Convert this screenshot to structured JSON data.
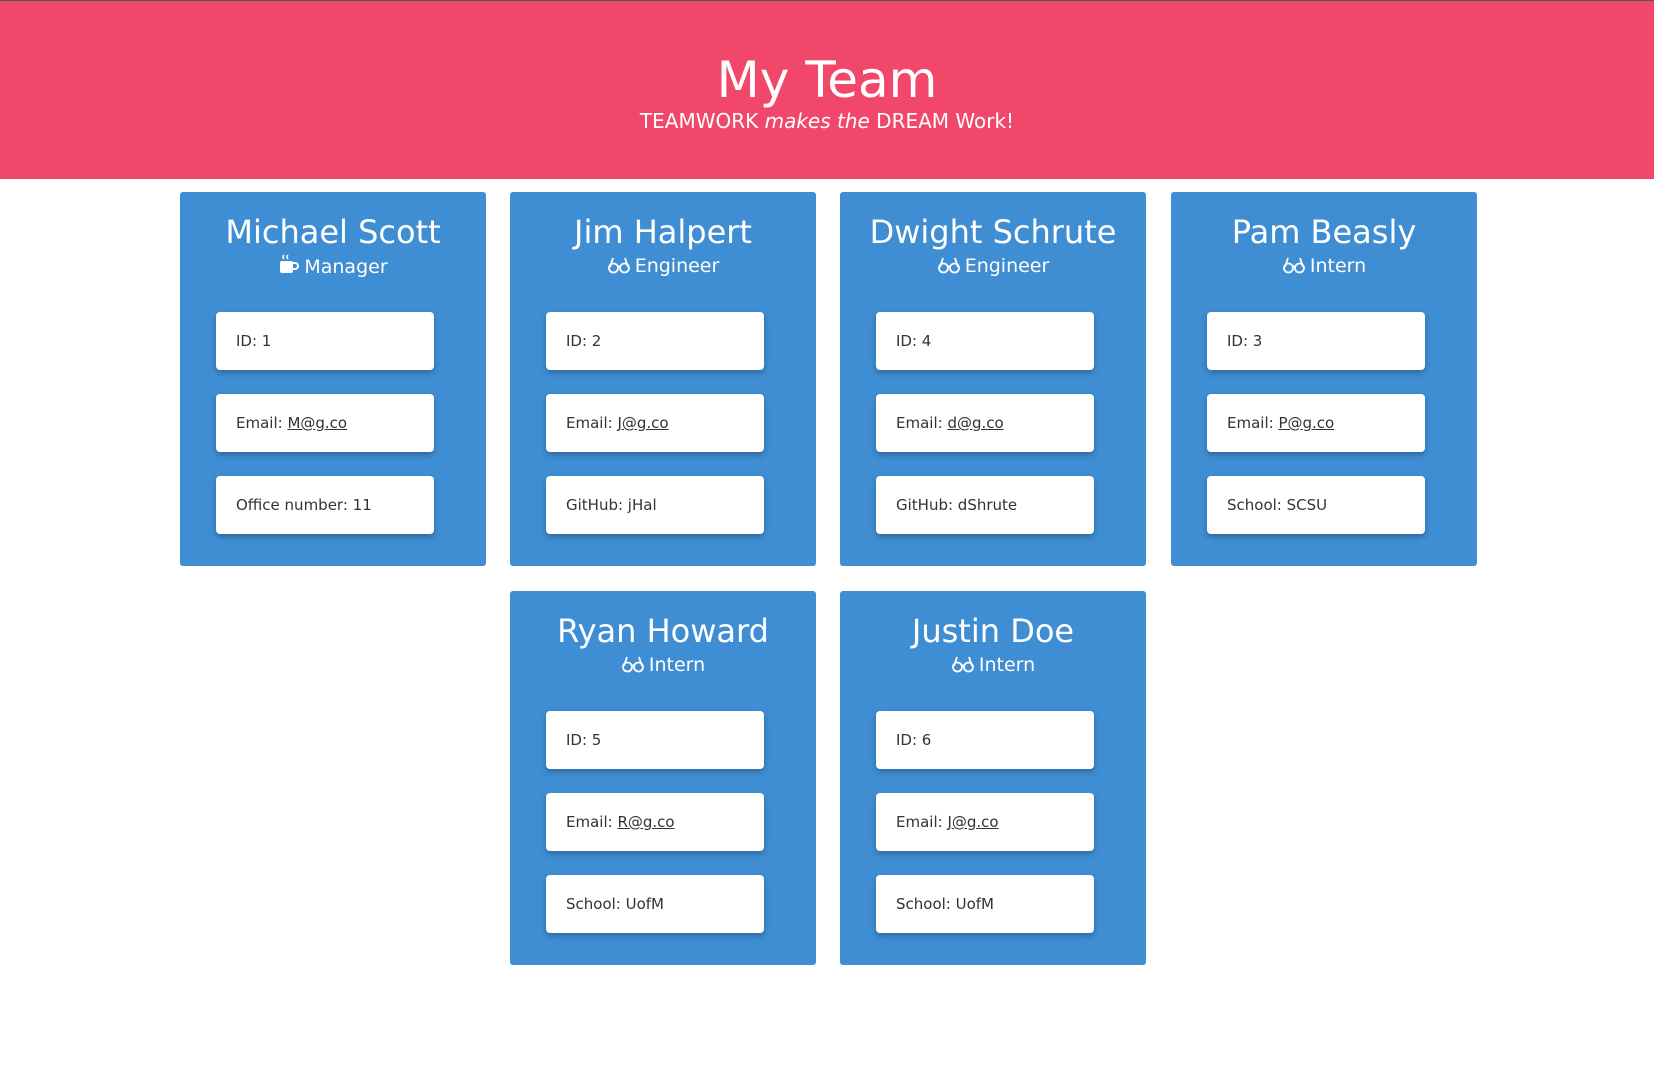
{
  "header": {
    "title": "My Team",
    "tagline_part1": "TEAMWORK ",
    "tagline_italic": "makes the",
    "tagline_part2": " DREAM Work!"
  },
  "colors": {
    "header_bg": "#f1476b",
    "card_bg": "#3f8dd2",
    "card_text": "#ffffff",
    "item_bg": "#ffffff"
  },
  "team": [
    {
      "name": "Michael Scott",
      "role": "Manager",
      "role_icon": "coffee-mug-icon",
      "id_label": "ID: 1",
      "email_label": "Email: ",
      "email": "M@g.co",
      "extra_label": "Office number: 11"
    },
    {
      "name": "Jim Halpert",
      "role": "Engineer",
      "role_icon": "glasses-icon",
      "id_label": "ID: 2",
      "email_label": "Email: ",
      "email": "J@g.co",
      "extra_label": "GitHub: jHal"
    },
    {
      "name": "Dwight Schrute",
      "role": "Engineer",
      "role_icon": "glasses-icon",
      "id_label": "ID: 4",
      "email_label": "Email: ",
      "email": "d@g.co",
      "extra_label": "GitHub: dShrute"
    },
    {
      "name": "Pam Beasly",
      "role": "Intern",
      "role_icon": "glasses-icon",
      "id_label": "ID: 3",
      "email_label": "Email: ",
      "email": "P@g.co",
      "extra_label": "School: SCSU"
    },
    {
      "name": "Ryan Howard",
      "role": "Intern",
      "role_icon": "glasses-icon",
      "id_label": "ID: 5",
      "email_label": "Email: ",
      "email": "R@g.co",
      "extra_label": "School: UofM"
    },
    {
      "name": "Justin Doe",
      "role": "Intern",
      "role_icon": "glasses-icon",
      "id_label": "ID: 6",
      "email_label": "Email: ",
      "email": "J@g.co",
      "extra_label": "School: UofM"
    }
  ]
}
